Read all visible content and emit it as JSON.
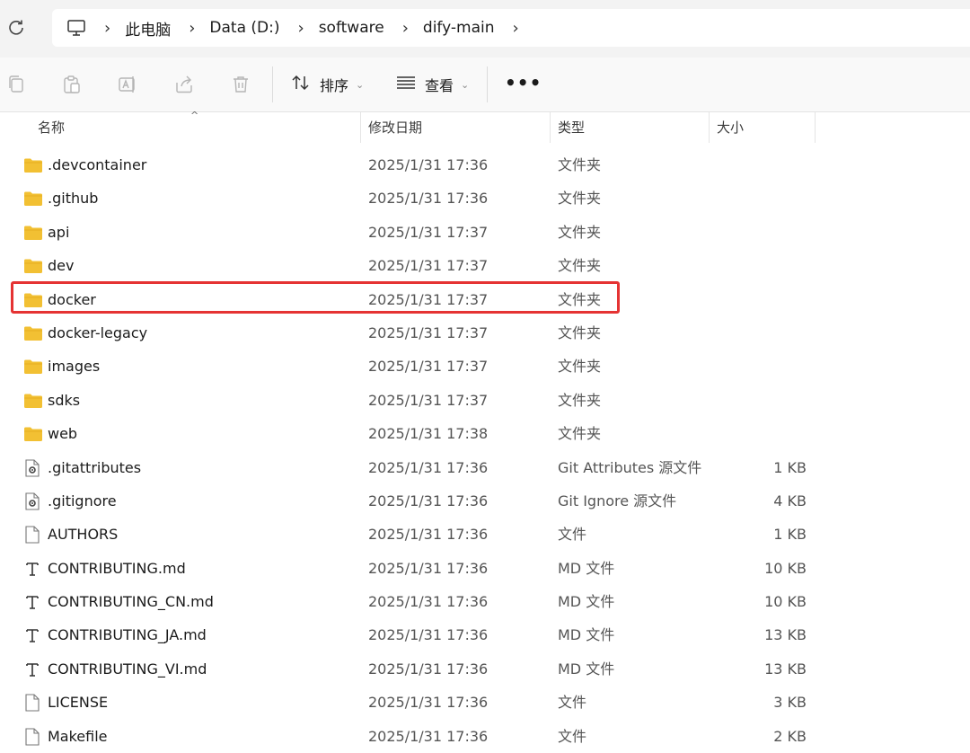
{
  "address_bar": {
    "breadcrumbs": [
      "此电脑",
      "Data (D:)",
      "software",
      "dify-main"
    ]
  },
  "toolbar": {
    "sort_label": "排序",
    "view_label": "查看",
    "more_label": "•••"
  },
  "columns": {
    "name": "名称",
    "date": "修改日期",
    "type": "类型",
    "size": "大小"
  },
  "files": [
    {
      "name": ".devcontainer",
      "date": "2025/1/31 17:36",
      "type": "文件夹",
      "size": "",
      "icon": "folder-icon"
    },
    {
      "name": ".github",
      "date": "2025/1/31 17:36",
      "type": "文件夹",
      "size": "",
      "icon": "folder-icon"
    },
    {
      "name": "api",
      "date": "2025/1/31 17:37",
      "type": "文件夹",
      "size": "",
      "icon": "folder-icon"
    },
    {
      "name": "dev",
      "date": "2025/1/31 17:37",
      "type": "文件夹",
      "size": "",
      "icon": "folder-icon"
    },
    {
      "name": "docker",
      "date": "2025/1/31 17:37",
      "type": "文件夹",
      "size": "",
      "icon": "folder-icon",
      "highlighted": true
    },
    {
      "name": "docker-legacy",
      "date": "2025/1/31 17:37",
      "type": "文件夹",
      "size": "",
      "icon": "folder-icon"
    },
    {
      "name": "images",
      "date": "2025/1/31 17:37",
      "type": "文件夹",
      "size": "",
      "icon": "folder-icon"
    },
    {
      "name": "sdks",
      "date": "2025/1/31 17:37",
      "type": "文件夹",
      "size": "",
      "icon": "folder-icon"
    },
    {
      "name": "web",
      "date": "2025/1/31 17:38",
      "type": "文件夹",
      "size": "",
      "icon": "folder-icon"
    },
    {
      "name": ".gitattributes",
      "date": "2025/1/31 17:36",
      "type": "Git Attributes 源文件",
      "size": "1 KB",
      "icon": "gear-file-icon"
    },
    {
      "name": ".gitignore",
      "date": "2025/1/31 17:36",
      "type": "Git Ignore 源文件",
      "size": "4 KB",
      "icon": "gear-file-icon"
    },
    {
      "name": "AUTHORS",
      "date": "2025/1/31 17:36",
      "type": "文件",
      "size": "1 KB",
      "icon": "blank-file-icon"
    },
    {
      "name": "CONTRIBUTING.md",
      "date": "2025/1/31 17:36",
      "type": "MD 文件",
      "size": "10 KB",
      "icon": "text-file-icon"
    },
    {
      "name": "CONTRIBUTING_CN.md",
      "date": "2025/1/31 17:36",
      "type": "MD 文件",
      "size": "10 KB",
      "icon": "text-file-icon"
    },
    {
      "name": "CONTRIBUTING_JA.md",
      "date": "2025/1/31 17:36",
      "type": "MD 文件",
      "size": "13 KB",
      "icon": "text-file-icon"
    },
    {
      "name": "CONTRIBUTING_VI.md",
      "date": "2025/1/31 17:36",
      "type": "MD 文件",
      "size": "13 KB",
      "icon": "text-file-icon"
    },
    {
      "name": "LICENSE",
      "date": "2025/1/31 17:36",
      "type": "文件",
      "size": "3 KB",
      "icon": "blank-file-icon"
    },
    {
      "name": "Makefile",
      "date": "2025/1/31 17:36",
      "type": "文件",
      "size": "2 KB",
      "icon": "blank-file-icon"
    }
  ],
  "colors": {
    "folder": "#f2c033",
    "highlight_border": "#e53333"
  }
}
